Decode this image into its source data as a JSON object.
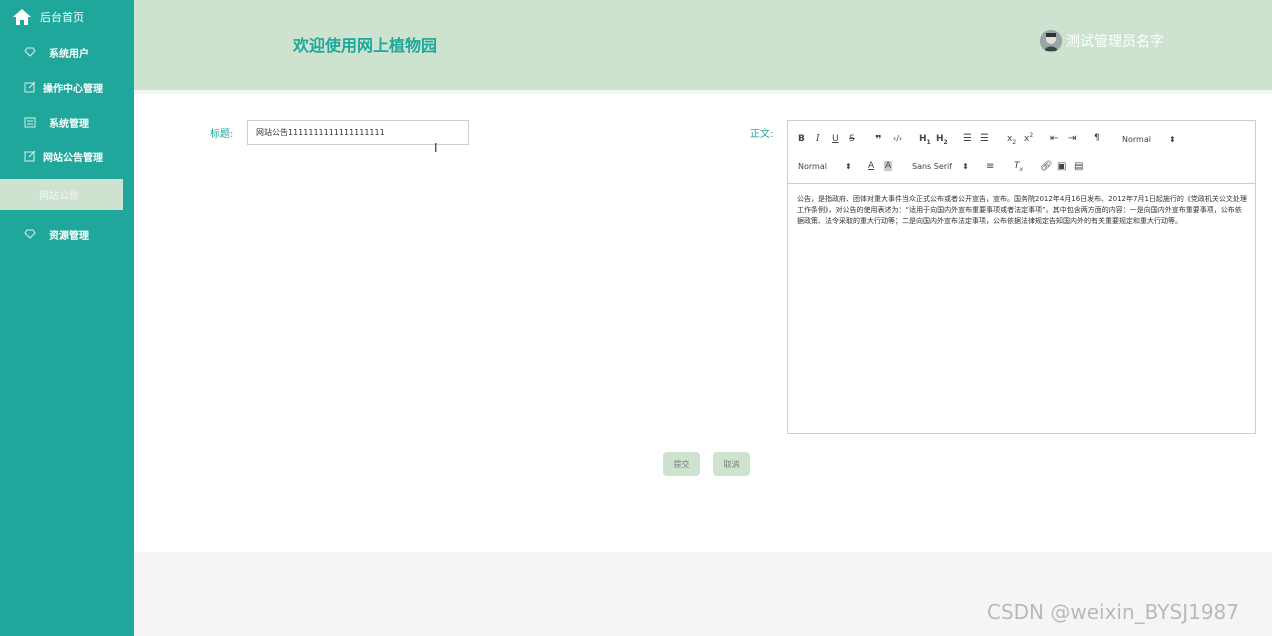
{
  "sidebar": {
    "home_label": "后台首页",
    "items": [
      {
        "label": "系统用户",
        "icon": "diamond-icon"
      },
      {
        "label": "操作中心管理",
        "icon": "edit-icon"
      },
      {
        "label": "系统管理",
        "icon": "message-icon"
      },
      {
        "label": "网站公告管理",
        "icon": "edit-icon"
      },
      {
        "label": "资源管理",
        "icon": "diamond-icon"
      }
    ],
    "active_sub_item": "网站公告"
  },
  "header": {
    "title": "欢迎使用网上植物园",
    "user_name": "测试管理员名字"
  },
  "form": {
    "title_label": "标题:",
    "title_value": "网站公告1111111111111111111",
    "content_label": "正文:",
    "toolbar": {
      "header_select": "Normal",
      "size_select": "Normal",
      "font_select": "Sans Serif"
    },
    "content_text": "公告，是指政府、团体对重大事件当众正式公布或者公开宣告，宣布。国务院2012年4月16日发布、2012年7月1日起施行的《党政机关公文处理工作条例》，对公告的使用表述为：“适用于向国内外宣布重要事项或者法定事项”。其中包含两方面的内容：一是向国内外宣布重要事项，公布依据政策、法令采取的重大行动等；二是向国内外宣布法定事项，公布依据法律规定告知国内外的有关重要规定和重大行动等。",
    "submit_label": "提交",
    "cancel_label": "取消"
  },
  "watermark": "CSDN @weixin_BYSJ1987",
  "colors": {
    "sidebar": "#1fa79b",
    "header": "#cde3cf",
    "accent": "#1fa79b"
  }
}
